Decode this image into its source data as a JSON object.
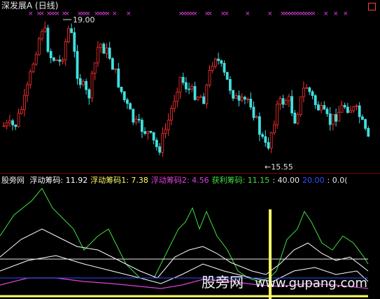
{
  "header": {
    "title": "深发展A (日线)"
  },
  "price_panel": {
    "high_label": "19.00",
    "low_label": "←15.55",
    "marker_glyph": "×"
  },
  "indicator": {
    "name": "股旁网",
    "items": [
      {
        "label": "浮动筹码:",
        "value": "11.92",
        "color": "#ffffff"
      },
      {
        "label": "浮动筹码1:",
        "value": "7.38",
        "color": "#ffff66"
      },
      {
        "label": "浮动筹码2:",
        "value": "4.56",
        "color": "#e040e0"
      },
      {
        "label": "获利筹码:",
        "value": "11.15",
        "color": "#40e040"
      },
      {
        "label": ":",
        "value": "40.00",
        "color": "#e8e8e8"
      },
      {
        "label": "",
        "value": "20.00",
        "color": "#3050ff"
      },
      {
        "label": ":",
        "value": "0.0(",
        "color": "#e8e8e8"
      }
    ]
  },
  "watermark": {
    "text": "股旁网",
    "url": "www.gupang.com"
  },
  "colors": {
    "up": "#ff3030",
    "down": "#40e0e0",
    "marker": "#e040e0",
    "green_line": "#40e040",
    "white_line": "#ffffff",
    "purple_line": "#e040e0",
    "yellow_line": "#ffff66"
  }
}
